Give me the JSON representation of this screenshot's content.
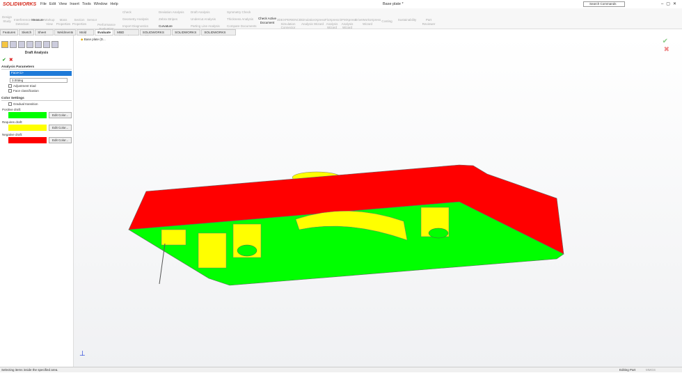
{
  "app": {
    "logo": "SOLIDWORKS",
    "menus": [
      "File",
      "Edit",
      "View",
      "Insert",
      "Tools",
      "Window",
      "Help"
    ],
    "document_title": "Base plate *",
    "search_placeholder": "Search Commands"
  },
  "ribbon": {
    "buttons": [
      "Design Study",
      "Interference Detection",
      "Measure",
      "Markup View",
      "Mass Properties",
      "Section Properties",
      "Sensor",
      "Performance Evaluation",
      "Check Active Document",
      "3DEXPERIENCE Simulation Connector",
      "SimulationXpress Analysis Wizard",
      "FloXpress Analysis Wizard",
      "DFMXpress Analysis Wizard",
      "DriveWorksXpress Wizard",
      "Costing",
      "Sustainability",
      "Part Reviewer"
    ],
    "small": [
      "Check",
      "Geometry Analysis",
      "Import Diagnostics",
      "Deviation Analysis",
      "Zebra Stripes",
      "Curvature",
      "Draft Analysis",
      "Undercut Analysis",
      "Parting Line Analysis",
      "Symmetry Check",
      "Thickness Analysis",
      "Compare Documents"
    ]
  },
  "tabs": [
    "Features",
    "Sketch",
    "Sheet Metal",
    "Weldments",
    "Mold Tools",
    "Evaluate",
    "MBD Dimensions",
    "SOLIDWORKS Add-Ins",
    "SOLIDWORKS CAM",
    "SOLIDWORKS CAM TBM"
  ],
  "active_tab": "Evaluate",
  "tree": {
    "item": "Base plate (D..."
  },
  "panel": {
    "title": "Draft Analysis",
    "analysis_params": "Analysis Parameters",
    "face_value": "Face<1>",
    "angle_value": "3.00deg",
    "adjustment_triad": "Adjustment triad",
    "face_classification": "Face classification",
    "color_settings": "Color Settings",
    "gradual_transition": "Gradual transition",
    "positive": "Positive draft:",
    "requires": "Requires draft:",
    "negative": "Negative draft:",
    "edit_color": "Edit Color...",
    "colors": {
      "positive": "#00ff00",
      "requires": "#ffff00",
      "negative": "#ff0000"
    }
  },
  "status": {
    "message": "Selecting items inside the specified area.",
    "mode": "Editing Part",
    "units": "MMGS"
  }
}
